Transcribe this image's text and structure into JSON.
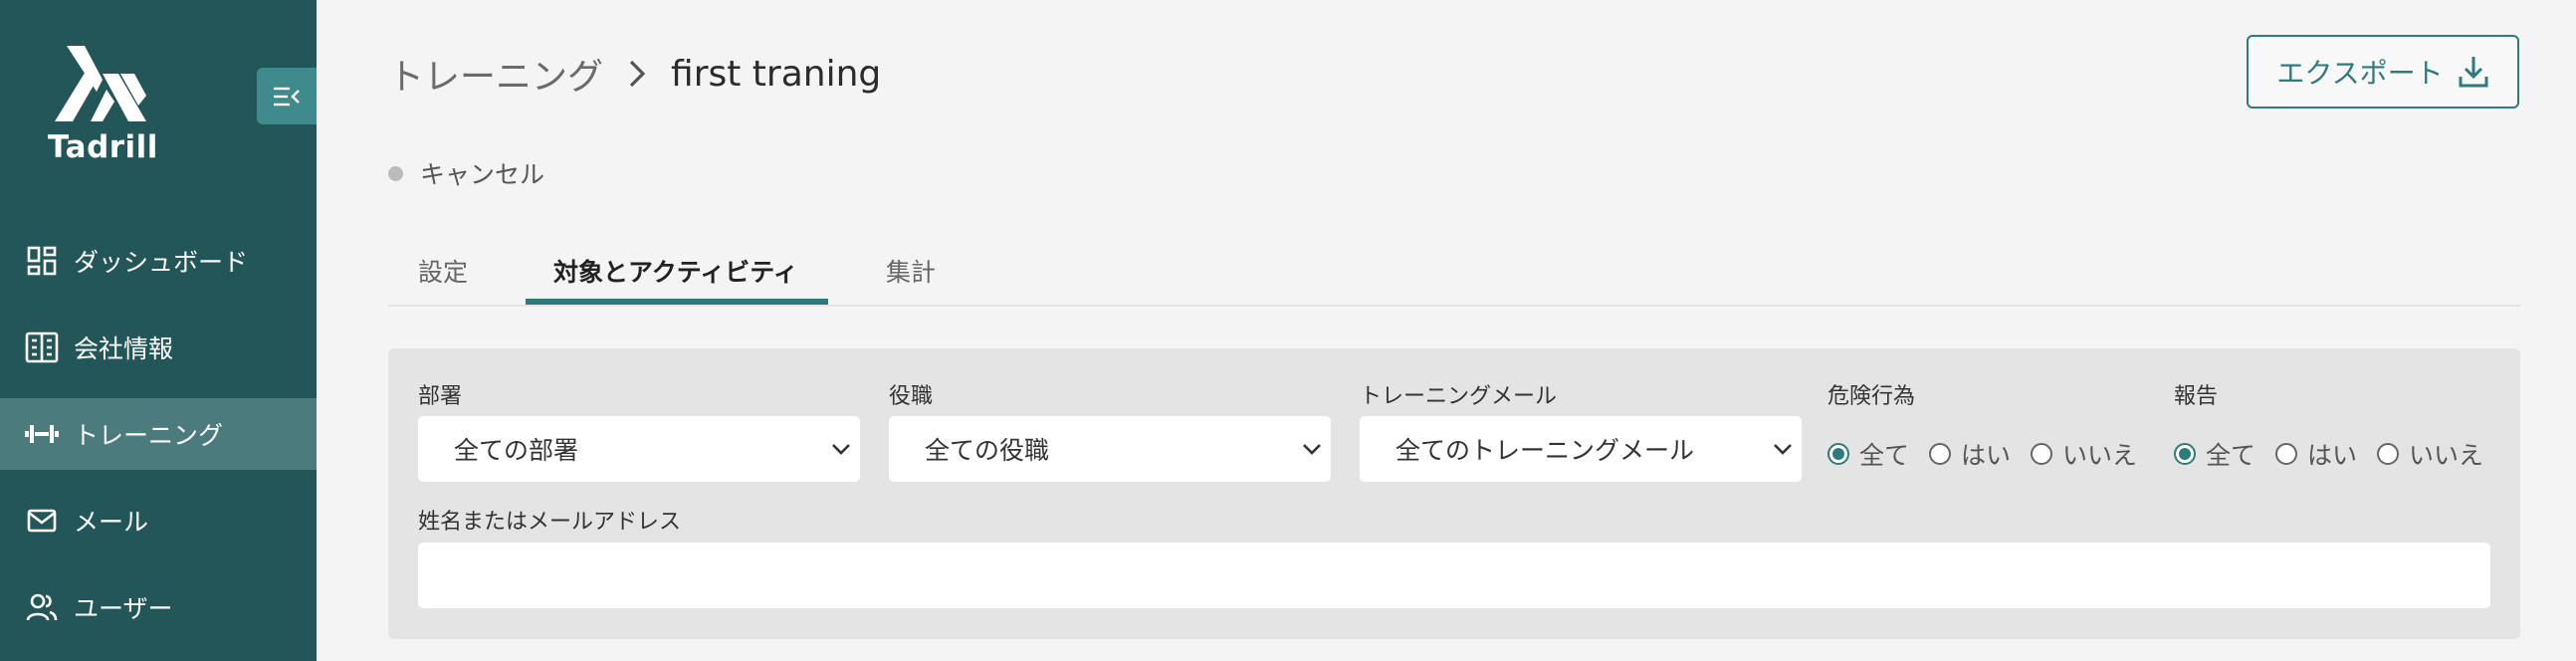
{
  "app": {
    "name": "Tadrill"
  },
  "sidebar": {
    "items": [
      {
        "label": "ダッシュボード",
        "icon": "dashboard-icon",
        "active": false
      },
      {
        "label": "会社情報",
        "icon": "building-icon",
        "active": false
      },
      {
        "label": "トレーニング",
        "icon": "dumbbell-icon",
        "active": true
      },
      {
        "label": "メール",
        "icon": "mail-icon",
        "active": false
      },
      {
        "label": "ユーザー",
        "icon": "users-icon",
        "active": false
      }
    ]
  },
  "header": {
    "breadcrumb_parent": "トレーニング",
    "breadcrumb_current": "first traning",
    "export_label": "エクスポート"
  },
  "status": {
    "label": "キャンセル"
  },
  "tabs": [
    {
      "label": "設定",
      "active": false
    },
    {
      "label": "対象とアクティビティ",
      "active": true
    },
    {
      "label": "集計",
      "active": false
    }
  ],
  "filters": {
    "department": {
      "label": "部署",
      "value": "全ての部署"
    },
    "position": {
      "label": "役職",
      "value": "全ての役職"
    },
    "training_mail": {
      "label": "トレーニングメール",
      "value": "全てのトレーニングメール"
    },
    "risky_action": {
      "label": "危険行為",
      "options": [
        "全て",
        "はい",
        "いいえ"
      ],
      "selected": "全て"
    },
    "report": {
      "label": "報告",
      "options": [
        "全て",
        "はい",
        "いいえ"
      ],
      "selected": "全て"
    },
    "name_email": {
      "label": "姓名またはメールアドレス",
      "value": "",
      "placeholder": ""
    }
  },
  "colors": {
    "sidebar": "#235659",
    "accent": "#2e7a7c",
    "active_nav": "#4b7b7c"
  }
}
